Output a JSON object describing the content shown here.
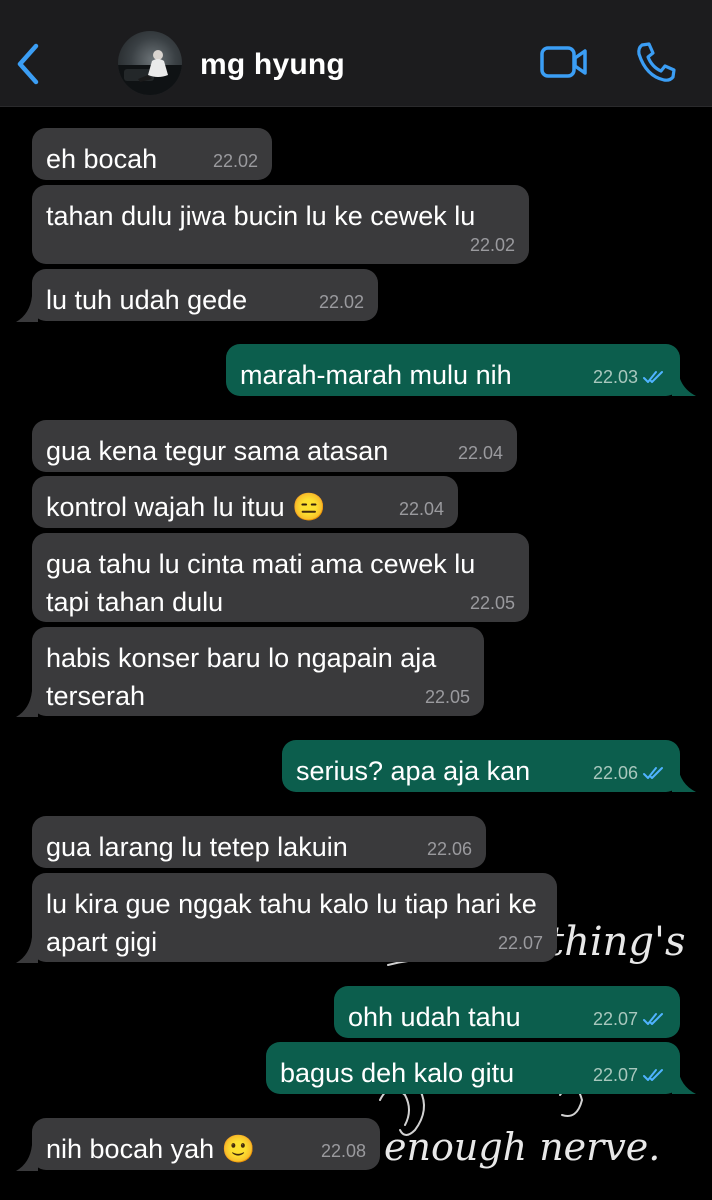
{
  "header": {
    "contact_name": "mg hyung",
    "back_icon": "chevron-left-icon",
    "video_icon": "video-camera-icon",
    "call_icon": "phone-icon",
    "accent_color": "#3b9ef5"
  },
  "background": {
    "line1": "thing's",
    "line2": "enough nerve."
  },
  "messages": [
    {
      "side": "in",
      "text": "eh bocah",
      "time": "22.02"
    },
    {
      "side": "in",
      "text": "tahan dulu jiwa bucin lu ke cewek lu",
      "time": "22.02"
    },
    {
      "side": "in",
      "text": "lu tuh udah gede",
      "time": "22.02"
    },
    {
      "side": "out",
      "text": "marah-marah mulu nih",
      "time": "22.03",
      "read": true
    },
    {
      "side": "in",
      "text": "gua kena tegur sama atasan",
      "time": "22.04"
    },
    {
      "side": "in",
      "text": "kontrol wajah lu ituu 😑",
      "time": "22.04"
    },
    {
      "side": "in",
      "text": "gua tahu lu cinta mati ama cewek lu tapi tahan dulu",
      "time": "22.05"
    },
    {
      "side": "in",
      "text": "habis konser baru lo ngapain aja terserah",
      "time": "22.05"
    },
    {
      "side": "out",
      "text": "serius? apa aja kan",
      "time": "22.06",
      "read": true
    },
    {
      "side": "in",
      "text": "gua larang lu tetep lakuin",
      "time": "22.06"
    },
    {
      "side": "in",
      "text": "lu kira gue nggak tahu kalo lu tiap hari ke apart gigi",
      "time": "22.07"
    },
    {
      "side": "out",
      "text": "ohh udah tahu",
      "time": "22.07",
      "read": true
    },
    {
      "side": "out",
      "text": "bagus deh kalo gitu",
      "time": "22.07",
      "read": true
    },
    {
      "side": "in",
      "text": "nih bocah yah 🙂",
      "time": "22.08"
    }
  ]
}
